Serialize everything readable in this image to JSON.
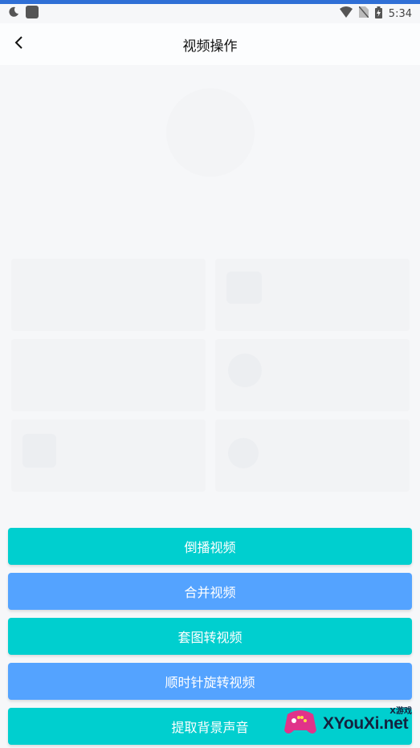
{
  "status_bar": {
    "time": "5:34",
    "icons": [
      "moon-icon",
      "app-square-icon",
      "wifi-icon",
      "no-sim-icon",
      "battery-charging-icon"
    ]
  },
  "header": {
    "title": "视频操作",
    "back_icon": "chevron-left-icon"
  },
  "actions": [
    {
      "label": "倒播视频",
      "color": "#00cfcf"
    },
    {
      "label": "合并视频",
      "color": "#54a3ff"
    },
    {
      "label": "套图转视频",
      "color": "#00cfcf"
    },
    {
      "label": "顺时针旋转视频",
      "color": "#54a3ff"
    },
    {
      "label": "提取背景声音",
      "color": "#00cfcf"
    }
  ],
  "watermark": {
    "text": "XYouXi.net",
    "tag": "X游戏"
  }
}
